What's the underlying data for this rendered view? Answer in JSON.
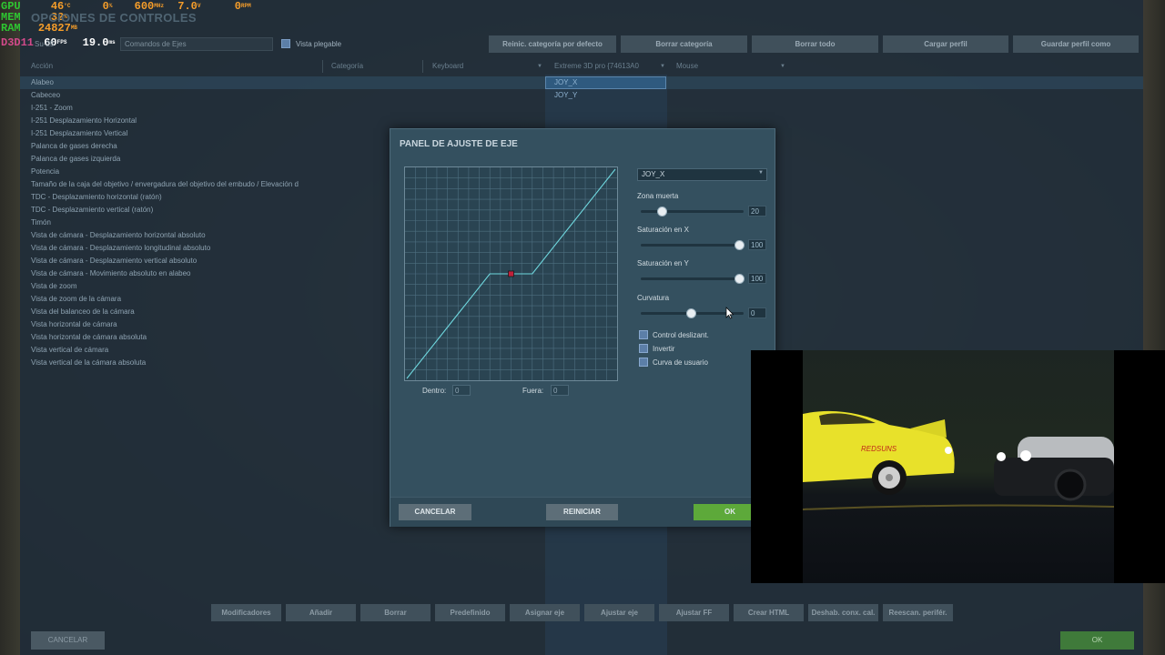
{
  "osd": {
    "gpu": {
      "label": "GPU",
      "temp": "46",
      "temp_unit": "°C",
      "load": "0",
      "load_unit": "%",
      "clock": "600",
      "clock_unit": "MHz",
      "volt": "7.0",
      "volt_unit": "V",
      "rpm": "0",
      "rpm_unit": "RPM"
    },
    "mem": {
      "label": "MEM",
      "value": "32",
      "unit": "%"
    },
    "ram": {
      "label": "RAM",
      "value": "24827",
      "unit": "MB"
    },
    "d3d": {
      "label": "D3D11",
      "fps": "60",
      "fps_unit": "FPS",
      "frametime": "19.0",
      "frametime_unit": "ms"
    }
  },
  "page_title": "OPCIONES DE CONTROLES",
  "filter_select": {
    "aircraft": "Su-25",
    "value": "Comandos de Ejes"
  },
  "collapsible_view_label": "Vista plegable",
  "toolbar": {
    "reset_category": "Reinic. categoría por defecto",
    "clear_category": "Borrar categoría",
    "clear_all": "Borrar todo",
    "load_profile": "Cargar perfil",
    "save_profile_as": "Guardar perfil como"
  },
  "columns": {
    "action": "Acción",
    "category": "Categoría",
    "keyboard": "Keyboard",
    "joystick": "Extreme 3D pro {74613A0",
    "mouse": "Mouse"
  },
  "actions": [
    "Alabeo",
    "Cabeceo",
    "I-251 - Zoom",
    "I-251 Desplazamiento Horizontal",
    "I-251 Desplazamiento Vertical",
    "Palanca de gases derecha",
    "Palanca de gases izquierda",
    "Potencia",
    "Tamaño de la caja del objetivo / envergadura del objetivo del embudo / Elevación d",
    "TDC - Desplazamiento horizontal (ratón)",
    "TDC - Desplazamiento vertical (ratón)",
    "Timón",
    "Vista de cámara - Desplazamiento horizontal absoluto",
    "Vista de cámara - Desplazamiento longitudinal absoluto",
    "Vista de cámara - Desplazamiento vertical absoluto",
    "Vista de cámara - Movimiento absoluto en alabeo",
    "Vista de zoom",
    "Vista de zoom de la cámara",
    "Vista del balanceo de la cámara",
    "Vista horizontal de cámara",
    "Vista horizontal de cámara absoluta",
    "Vista vertical de cámara",
    "Vista vertical de la cámara absoluta"
  ],
  "joystick_bindings": [
    "JOY_X",
    "JOY_Y"
  ],
  "dialog": {
    "title": "PANEL DE AJUSTE DE EJE",
    "axis_select": "JOY_X",
    "deadzone": {
      "label": "Zona muerta",
      "value": "20",
      "level": 0.2
    },
    "saturation_x": {
      "label": "Saturación en X",
      "value": "100",
      "level": 1.0
    },
    "saturation_y": {
      "label": "Saturación en Y",
      "value": "100",
      "level": 1.0
    },
    "curvature": {
      "label": "Curvatura",
      "value": "0",
      "level": 0.5
    },
    "checkboxes": {
      "slider": "Control deslizant.",
      "invert": "Invertir",
      "user_curve": "Curva de usuario"
    },
    "inner_label": "Dentro:",
    "inner_value": "0",
    "outer_label": "Fuera:",
    "outer_value": "0",
    "cancel": "CANCELAR",
    "reset": "REINICIAR",
    "ok": "OK"
  },
  "video_overlay": {
    "car_decal": "REDSUNS"
  },
  "bottom_toolbar": {
    "modifiers": "Modificadores",
    "add": "Añadir",
    "delete": "Borrar",
    "default": "Predefinido",
    "assign_axis": "Asignar eje",
    "tune_axis": "Ajustar eje",
    "tune_ff": "Ajustar FF",
    "create_html": "Crear HTML",
    "disable_hotplug": "Deshab. conx. cal.",
    "rescan_devices": "Reescan. perifér."
  },
  "footer": {
    "cancel": "CANCELAR",
    "ok": "OK"
  },
  "colors": {
    "ok_green": "#5da93a",
    "accent_blue": "#5c7fa8",
    "curve": "#6fd7de"
  }
}
